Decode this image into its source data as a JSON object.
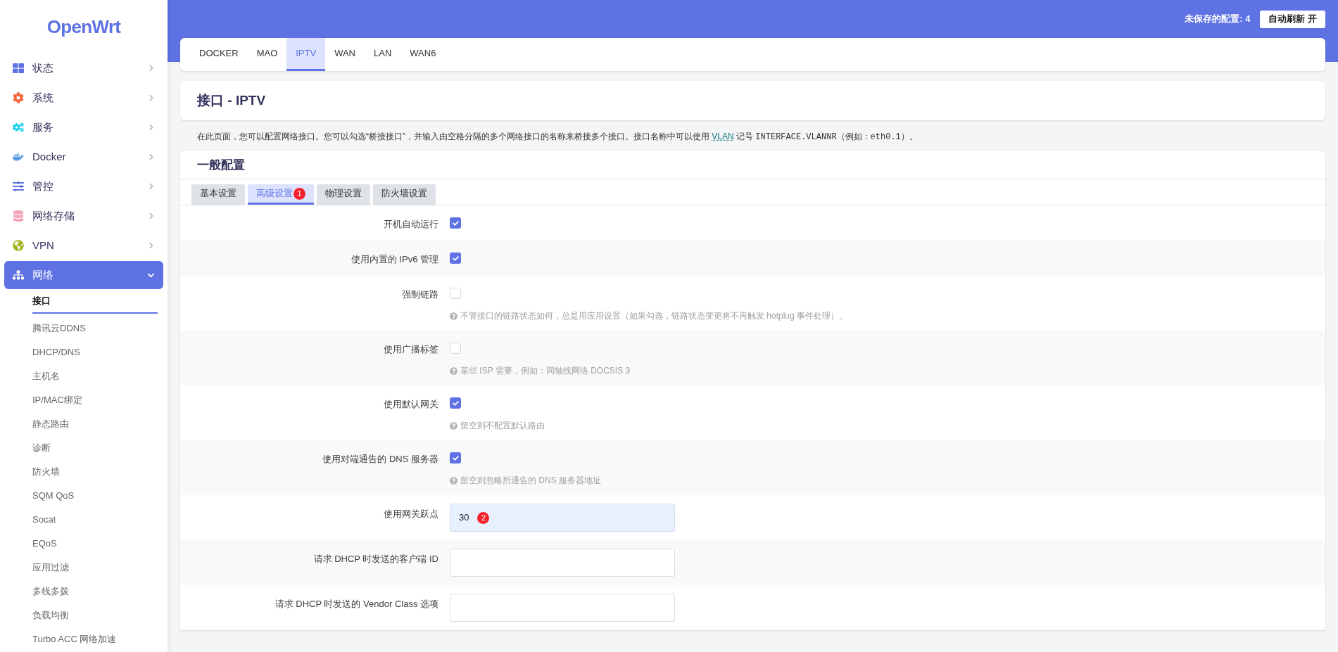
{
  "brand": "OpenWrt",
  "header": {
    "unsaved": "未保存的配置: 4",
    "refresh_button": "自动刷新 开"
  },
  "sidebar": {
    "items": [
      {
        "label": "状态",
        "expanded": false,
        "selected": false
      },
      {
        "label": "系统",
        "expanded": false,
        "selected": false
      },
      {
        "label": "服务",
        "expanded": false,
        "selected": false
      },
      {
        "label": "Docker",
        "expanded": false,
        "selected": false
      },
      {
        "label": "管控",
        "expanded": false,
        "selected": false
      },
      {
        "label": "网络存储",
        "expanded": false,
        "selected": false
      },
      {
        "label": "VPN",
        "expanded": false,
        "selected": false
      },
      {
        "label": "网络",
        "expanded": true,
        "selected": true,
        "children": [
          {
            "label": "接口",
            "selected": true
          },
          {
            "label": "腾讯云DDNS",
            "selected": false
          },
          {
            "label": "DHCP/DNS",
            "selected": false
          },
          {
            "label": "主机名",
            "selected": false
          },
          {
            "label": "IP/MAC绑定",
            "selected": false
          },
          {
            "label": "静态路由",
            "selected": false
          },
          {
            "label": "诊断",
            "selected": false
          },
          {
            "label": "防火墙",
            "selected": false
          },
          {
            "label": "SQM QoS",
            "selected": false
          },
          {
            "label": "Socat",
            "selected": false
          },
          {
            "label": "EQoS",
            "selected": false
          },
          {
            "label": "应用过滤",
            "selected": false
          },
          {
            "label": "多线多拨",
            "selected": false
          },
          {
            "label": "负载均衡",
            "selected": false
          },
          {
            "label": "Turbo ACC 网络加速",
            "selected": false
          }
        ]
      }
    ]
  },
  "interface_tabs": [
    {
      "label": "DOCKER",
      "selected": false
    },
    {
      "label": "MAO",
      "selected": false
    },
    {
      "label": "IPTV",
      "selected": true
    },
    {
      "label": "WAN",
      "selected": false
    },
    {
      "label": "LAN",
      "selected": false
    },
    {
      "label": "WAN6",
      "selected": false
    }
  ],
  "title": "接口 - IPTV",
  "description": [
    {
      "kind": "text",
      "text": "在此页面，您可以配置网络接口。您可以勾选“桥接接口”，并输入由空格分隔的多个网络接口的名称来桥接多个接口。接口名称中可以使用 "
    },
    {
      "kind": "link",
      "text": "VLAN"
    },
    {
      "kind": "text",
      "text": " 记号 "
    },
    {
      "kind": "code",
      "text": "INTERFACE.VLANNR"
    },
    {
      "kind": "text",
      "text": "（例如："
    },
    {
      "kind": "code",
      "text": "eth0.1"
    },
    {
      "kind": "text",
      "text": "）。"
    }
  ],
  "section": {
    "title": "一般配置",
    "tabs": [
      {
        "label": "基本设置",
        "selected": false
      },
      {
        "label": "高级设置",
        "selected": true,
        "badge": "1"
      },
      {
        "label": "物理设置",
        "selected": false
      },
      {
        "label": "防火墙设置",
        "selected": false
      }
    ],
    "rows": [
      {
        "kind": "checkbox",
        "label": "开机自动运行",
        "checked": true
      },
      {
        "kind": "checkbox",
        "label": "使用内置的 IPv6 管理",
        "checked": true
      },
      {
        "kind": "checkbox",
        "label": "强制链路",
        "checked": false,
        "help": "不管接口的链路状态如何，总是用应用设置（如果勾选，链路状态变更将不再触发 hotplug 事件处理）。"
      },
      {
        "kind": "checkbox",
        "label": "使用广播标签",
        "checked": false,
        "help": "某些 ISP 需要，例如：同轴线网络 DOCSIS 3"
      },
      {
        "kind": "checkbox",
        "label": "使用默认网关",
        "checked": true,
        "help": "留空则不配置默认路由"
      },
      {
        "kind": "checkbox",
        "label": "使用对端通告的 DNS 服务器",
        "checked": true,
        "help": "留空则忽略所通告的 DNS 服务器地址"
      },
      {
        "kind": "input",
        "label": "使用网关跃点",
        "value": "30",
        "badge": "2"
      },
      {
        "kind": "input",
        "label": "请求 DHCP 时发送的客户端 ID"
      },
      {
        "kind": "input",
        "label": "请求 DHCP 时发送的 Vendor Class 选项"
      }
    ]
  }
}
